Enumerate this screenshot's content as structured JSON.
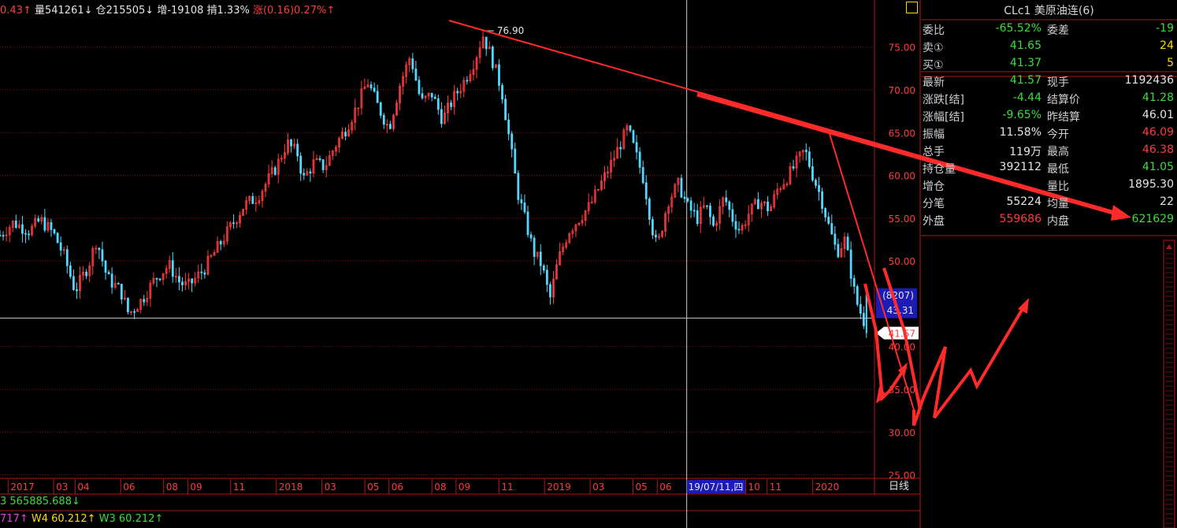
{
  "header": {
    "chg_val": "0.43↑",
    "vol": "量541261↓",
    "oi": "仓215505↓",
    "oi_chg": "增-19108",
    "amp": "掯1.33%",
    "rise": "涨(0.16)0.27%↑"
  },
  "indicators": {
    "line1": "3 565885.688↓",
    "line2_a": "717↑",
    "line2_w4": "W4 60.212↑",
    "line2_w3": "W3 60.212↑"
  },
  "panel": {
    "title": "CLc1 美原油连(6)",
    "rows": [
      {
        "l1": "委比",
        "v1": "-65.52%",
        "c1": "#3cdc3c",
        "l2": "委差",
        "v2": "-19",
        "c2": "#3cdc3c"
      },
      {
        "l1": "卖①",
        "v1": "41.65",
        "c1": "#3cdc3c",
        "l2": "",
        "v2": "24",
        "c2": "#ffd800"
      },
      {
        "l1": "买①",
        "v1": "41.37",
        "c1": "#3cdc3c",
        "l2": "",
        "v2": "5",
        "c2": "#ffd800"
      },
      {
        "l1": "最新",
        "v1": "41.57",
        "c1": "#3cdc3c",
        "l2": "现手",
        "v2": "1192436",
        "c2": "#e6e6e6"
      },
      {
        "l1": "涨跌[结]",
        "v1": "-4.44",
        "c1": "#3cdc3c",
        "l2": "结算价",
        "v2": "41.28",
        "c2": "#3cdc3c"
      },
      {
        "l1": "涨幅[结]",
        "v1": "-9.65%",
        "c1": "#3cdc3c",
        "l2": "昨结算",
        "v2": "46.01",
        "c2": "#e6e6e6"
      },
      {
        "l1": "振幅",
        "v1": "11.58%",
        "c1": "#e6e6e6",
        "l2": "今开",
        "v2": "46.09",
        "c2": "#ff3c3c"
      },
      {
        "l1": "总手",
        "v1": "119万",
        "c1": "#e6e6e6",
        "l2": "最高",
        "v2": "46.38",
        "c2": "#ff3c3c"
      },
      {
        "l1": "持仓量",
        "v1": "392112",
        "c1": "#e6e6e6",
        "l2": "最低",
        "v2": "41.05",
        "c2": "#3cdc3c"
      },
      {
        "l1": "增仓",
        "v1": "",
        "c1": "#e6e6e6",
        "l2": "量比",
        "v2": "1895.30",
        "c2": "#e6e6e6"
      },
      {
        "l1": "分笔",
        "v1": "55224",
        "c1": "#e6e6e6",
        "l2": "均量",
        "v2": "22",
        "c2": "#e6e6e6"
      },
      {
        "l1": "外盘",
        "v1": "559686",
        "c1": "#ff3c3c",
        "l2": "内盘",
        "v2": "621629",
        "c2": "#3cdc3c"
      }
    ]
  },
  "chart_data": {
    "type": "candlestick",
    "yticks": [
      "75.00",
      "70.00",
      "65.00",
      "60.00",
      "55.00",
      "50.00",
      "40.00",
      "35.00",
      "30.00",
      "25.00"
    ],
    "ytick_values": [
      75,
      70,
      65,
      60,
      55,
      50,
      40,
      35,
      30,
      25
    ],
    "ylim": [
      24.5,
      80.5
    ],
    "xticks": [
      "2017",
      "03",
      "04",
      "06",
      "08",
      "09",
      "11",
      "2018",
      "03",
      "05",
      "06",
      "08",
      "09",
      "11",
      "2019",
      "03",
      "05",
      "06",
      "10",
      "11",
      "2020"
    ],
    "xtick_values": [
      2017.0,
      2017.17,
      2017.25,
      2017.42,
      2017.58,
      2017.67,
      2017.83,
      2018.0,
      2018.17,
      2018.33,
      2018.42,
      2018.58,
      2018.67,
      2018.83,
      2019.0,
      2019.17,
      2019.33,
      2019.42,
      2019.75,
      2019.83,
      2020.0
    ],
    "xlim": [
      2016.97,
      2020.23
    ],
    "cursor_date_label": "19/07/11,四",
    "cursor_x": 2019.53,
    "cursor_price": 43.31,
    "cursor_count": "(8207)",
    "cursor_price_label": "43.31",
    "last_price": 41.57,
    "last_price_label": "41.57",
    "high_label": "76.90",
    "high_value": 76.9,
    "high_x": 2018.77,
    "up_color": "#ff3c3c",
    "down_color": "#54d8ff",
    "period_label": "日线",
    "trend_points": [
      [
        2016.97,
        53.0
      ],
      [
        2017.02,
        54.5
      ],
      [
        2017.08,
        53.5
      ],
      [
        2017.12,
        54.8
      ],
      [
        2017.17,
        53.2
      ],
      [
        2017.21,
        50.5
      ],
      [
        2017.25,
        46.5
      ],
      [
        2017.3,
        49.5
      ],
      [
        2017.33,
        52.5
      ],
      [
        2017.37,
        48.0
      ],
      [
        2017.42,
        46.5
      ],
      [
        2017.45,
        43.8
      ],
      [
        2017.5,
        45.5
      ],
      [
        2017.55,
        48.0
      ],
      [
        2017.6,
        49.5
      ],
      [
        2017.64,
        47.5
      ],
      [
        2017.67,
        47.0
      ],
      [
        2017.73,
        49.0
      ],
      [
        2017.78,
        51.5
      ],
      [
        2017.83,
        54.0
      ],
      [
        2017.88,
        56.5
      ],
      [
        2017.93,
        57.5
      ],
      [
        2017.97,
        59.5
      ],
      [
        2018.0,
        61.0
      ],
      [
        2018.04,
        63.8
      ],
      [
        2018.08,
        62.5
      ],
      [
        2018.1,
        59.5
      ],
      [
        2018.14,
        61.5
      ],
      [
        2018.18,
        61.0
      ],
      [
        2018.22,
        63.5
      ],
      [
        2018.26,
        65.5
      ],
      [
        2018.3,
        68.0
      ],
      [
        2018.34,
        71.0
      ],
      [
        2018.38,
        68.0
      ],
      [
        2018.42,
        65.5
      ],
      [
        2018.46,
        70.5
      ],
      [
        2018.5,
        74.0
      ],
      [
        2018.54,
        68.5
      ],
      [
        2018.58,
        69.5
      ],
      [
        2018.62,
        66.5
      ],
      [
        2018.66,
        69.0
      ],
      [
        2018.7,
        71.0
      ],
      [
        2018.74,
        73.5
      ],
      [
        2018.77,
        76.4
      ],
      [
        2018.8,
        74.0
      ],
      [
        2018.84,
        70.0
      ],
      [
        2018.87,
        64.0
      ],
      [
        2018.9,
        58.0
      ],
      [
        2018.93,
        54.5
      ],
      [
        2018.96,
        51.0
      ],
      [
        2018.99,
        49.5
      ],
      [
        2019.02,
        45.5
      ],
      [
        2019.05,
        50.0
      ],
      [
        2019.09,
        53.5
      ],
      [
        2019.13,
        55.0
      ],
      [
        2019.17,
        56.5
      ],
      [
        2019.21,
        59.0
      ],
      [
        2019.25,
        61.5
      ],
      [
        2019.28,
        63.5
      ],
      [
        2019.31,
        65.5
      ],
      [
        2019.34,
        62.5
      ],
      [
        2019.37,
        59.5
      ],
      [
        2019.4,
        54.0
      ],
      [
        2019.42,
        51.5
      ],
      [
        2019.46,
        57.0
      ],
      [
        2019.5,
        59.0
      ],
      [
        2019.53,
        56.5
      ],
      [
        2019.57,
        55.0
      ],
      [
        2019.6,
        56.5
      ],
      [
        2019.63,
        54.0
      ],
      [
        2019.67,
        57.5
      ],
      [
        2019.7,
        55.0
      ],
      [
        2019.73,
        53.5
      ],
      [
        2019.76,
        55.5
      ],
      [
        2019.8,
        57.0
      ],
      [
        2019.84,
        56.0
      ],
      [
        2019.87,
        58.5
      ],
      [
        2019.91,
        60.0
      ],
      [
        2019.94,
        61.5
      ],
      [
        2019.97,
        63.0
      ],
      [
        2020.0,
        60.0
      ],
      [
        2020.03,
        57.5
      ],
      [
        2020.06,
        54.0
      ],
      [
        2020.09,
        51.0
      ],
      [
        2020.12,
        52.5
      ],
      [
        2020.14,
        49.0
      ],
      [
        2020.16,
        45.5
      ],
      [
        2020.19,
        43.0
      ]
    ]
  }
}
